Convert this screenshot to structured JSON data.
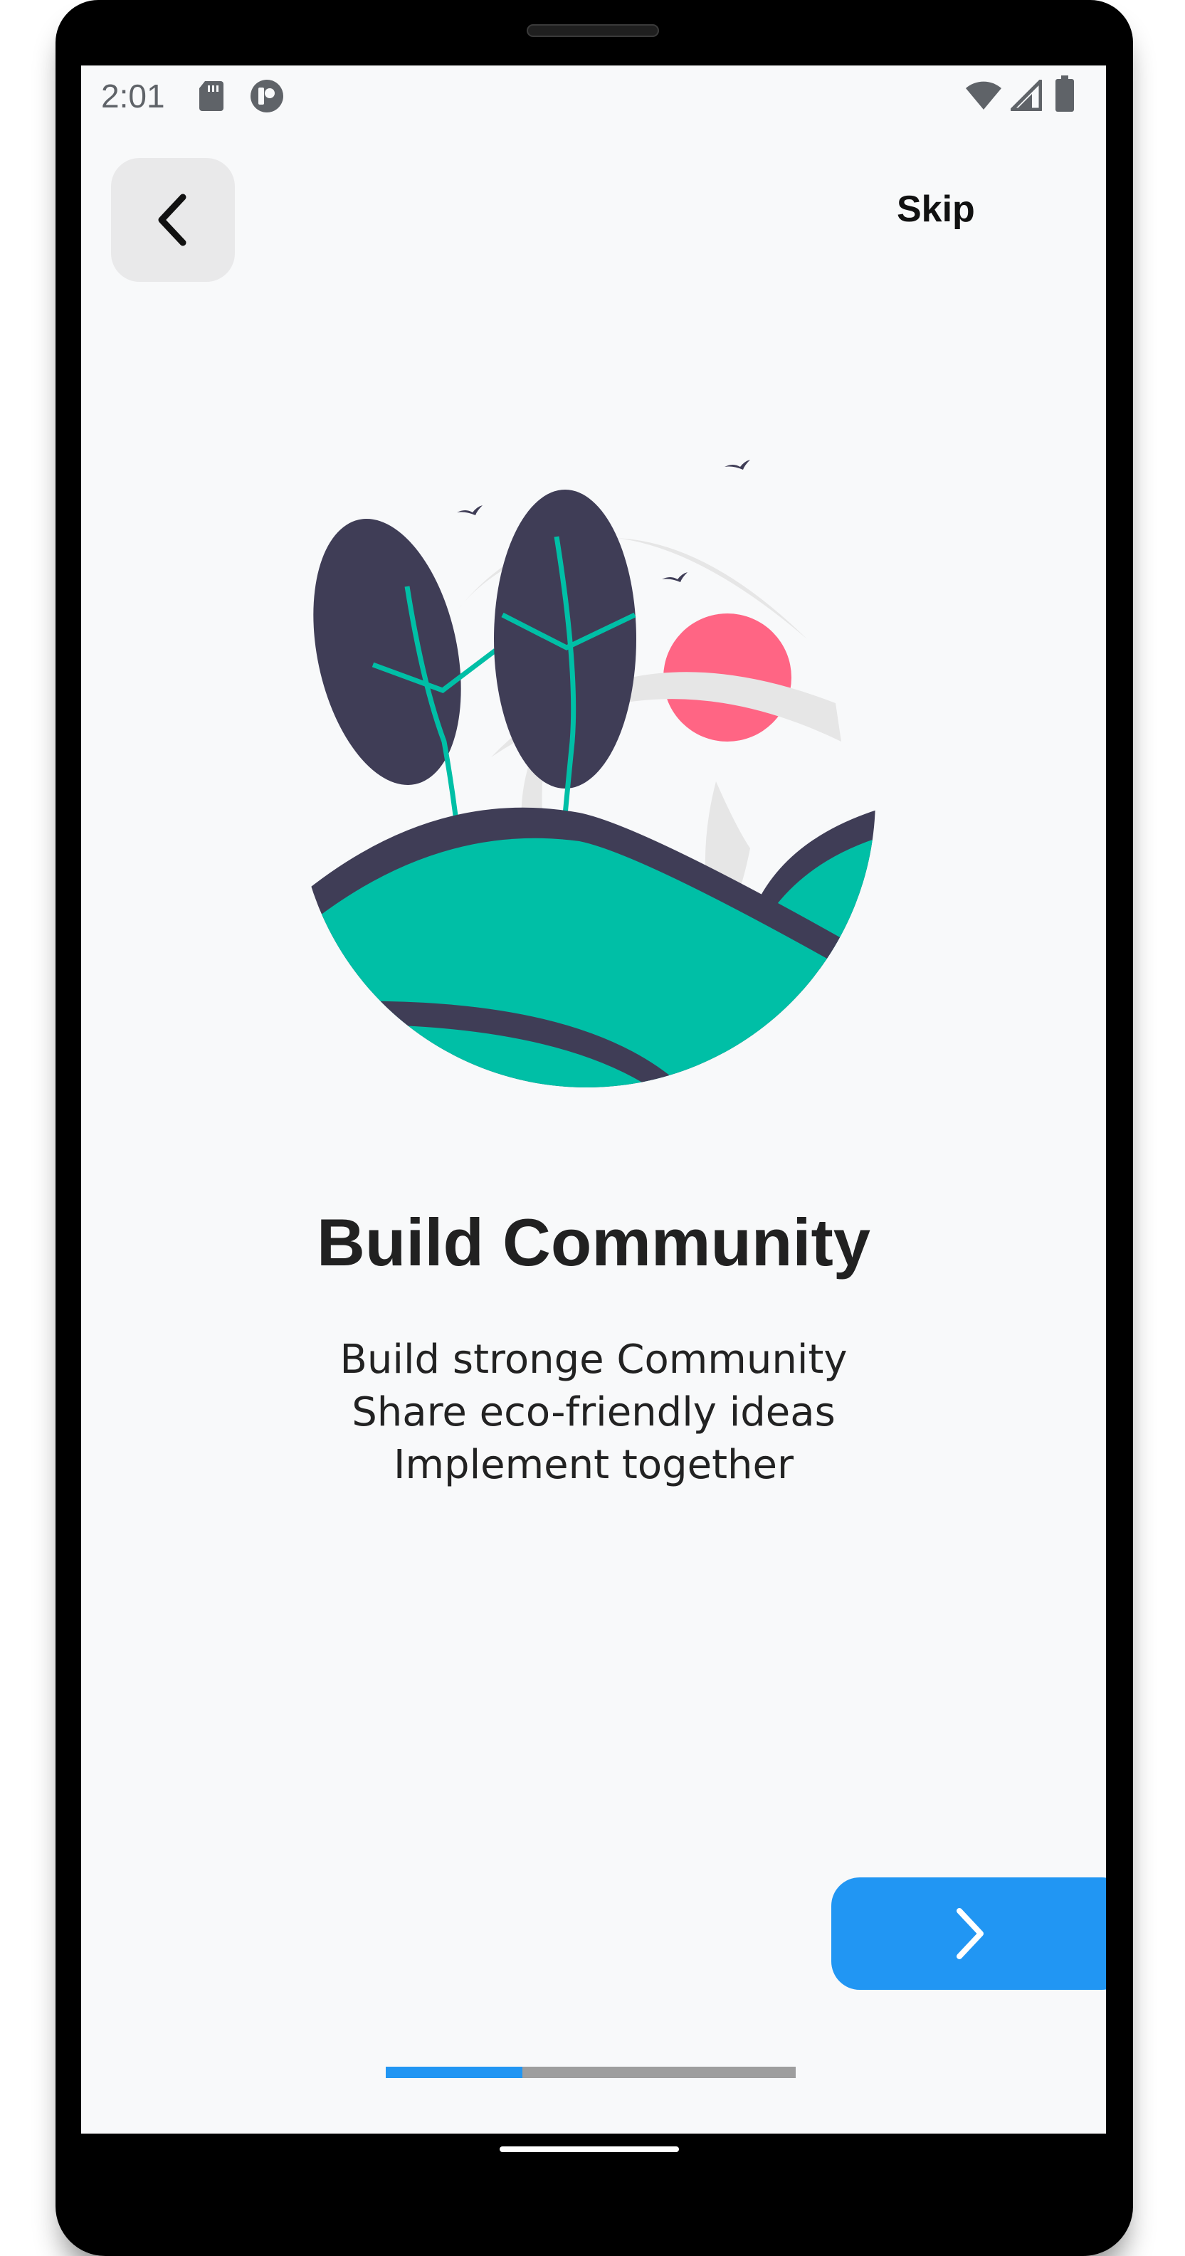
{
  "status_bar": {
    "time": "2:01",
    "left_icons": [
      "sd-card-icon",
      "notification-app-icon"
    ],
    "right_icons": [
      "wifi-icon",
      "cell-signal-icon",
      "battery-icon"
    ]
  },
  "header": {
    "back_icon": "chevron-left-icon",
    "skip_label": "Skip"
  },
  "onboarding": {
    "title": "Build Community",
    "description_lines": [
      "Build stronge Community",
      "Share eco-friendly ideas",
      "Implement together"
    ]
  },
  "next_button": {
    "icon": "chevron-right-icon",
    "color": "#2196F3"
  },
  "progress": {
    "current_page": 1,
    "total_pages": 3,
    "fraction": 0.333,
    "active_color": "#2196F3",
    "inactive_color": "#9E9E9E"
  },
  "colors": {
    "background": "#F8F9FA",
    "illustration_teal": "#00BFA6",
    "illustration_navy": "#3F3D56",
    "illustration_sun": "#FF6584",
    "illustration_gray": "#E6E6E6"
  }
}
